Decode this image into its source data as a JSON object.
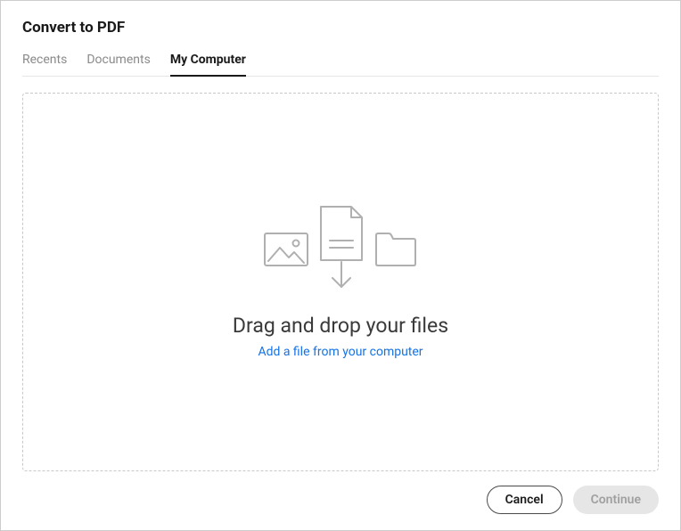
{
  "title": "Convert to PDF",
  "tabs": {
    "recents": "Recents",
    "documents": "Documents",
    "mycomputer": "My Computer"
  },
  "dropzone": {
    "main_text": "Drag and drop your files",
    "link_text": "Add a file from your computer"
  },
  "footer": {
    "cancel": "Cancel",
    "continue": "Continue"
  }
}
